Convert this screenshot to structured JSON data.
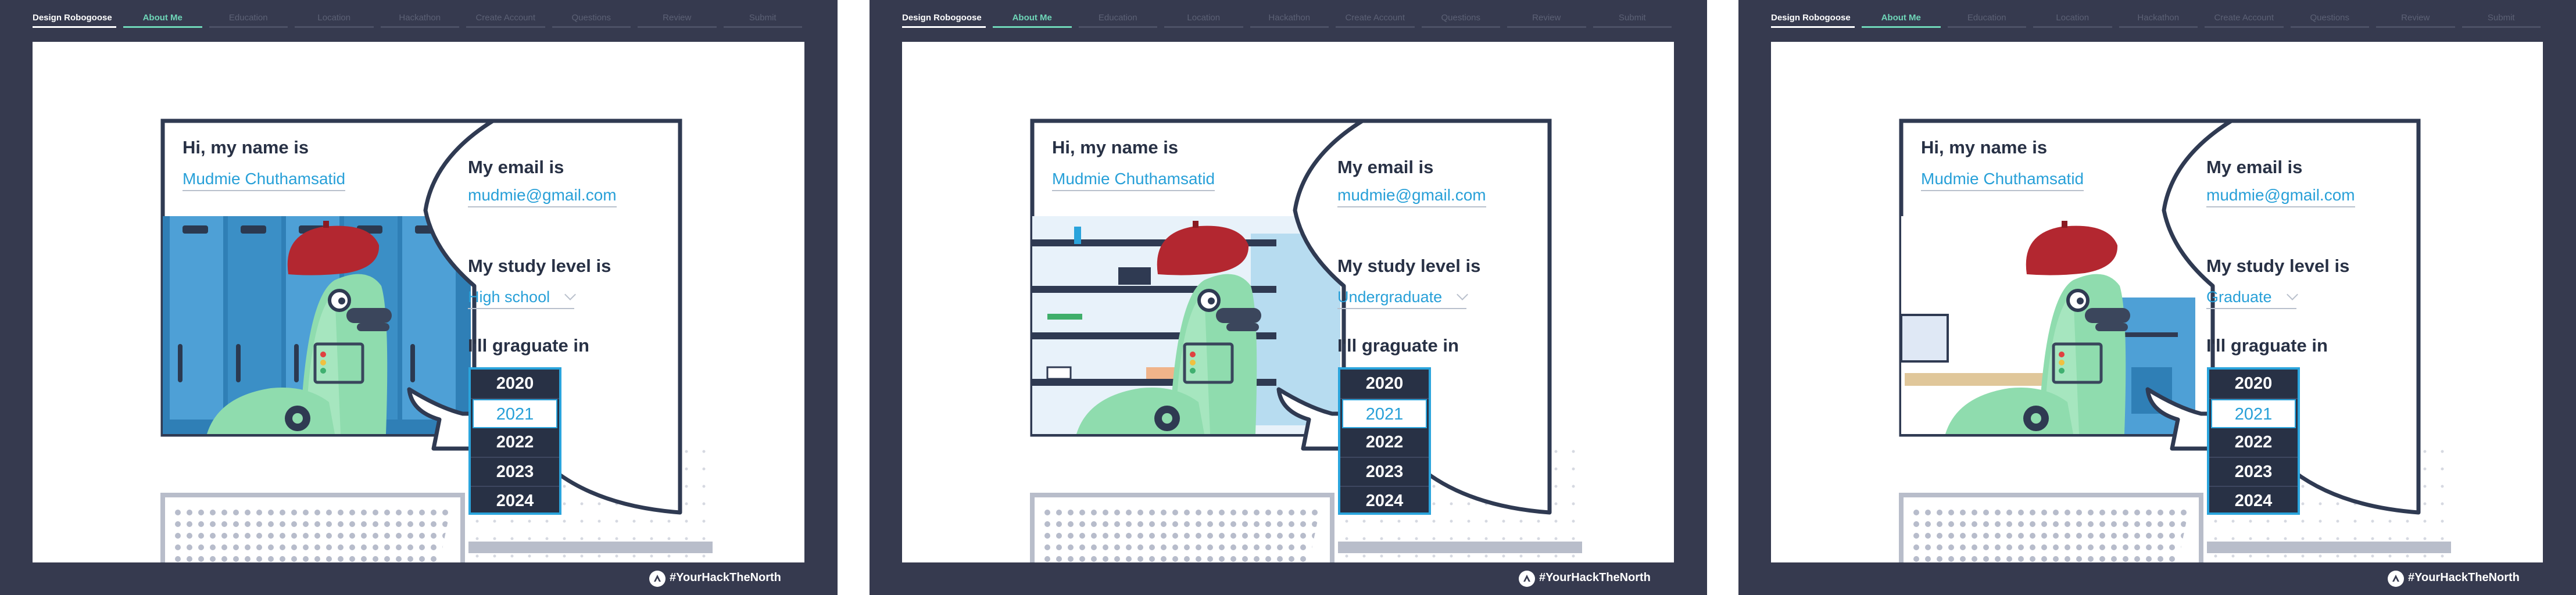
{
  "nav": {
    "brand": "Design Robogoose",
    "tabs": [
      "About Me",
      "Education",
      "Location",
      "Hackathon",
      "Create Account",
      "Questions",
      "Review",
      "Submit"
    ]
  },
  "form": {
    "name_label": "Hi, my name is",
    "email_label": "My email is",
    "study_label": "My study level is",
    "grad_label": "I'll graguate in",
    "grad_options": [
      "2020",
      "2021",
      "2022",
      "2023",
      "2024"
    ],
    "selected_year": "2021"
  },
  "screens": [
    {
      "name": "Mudmie Chuthamsatid",
      "email": "mudmie@gmail.com",
      "study_level": "High school",
      "scene": "lockers"
    },
    {
      "name": "Mudmie Chuthamsatid",
      "email": "mudmie@gmail.com",
      "study_level": "Undergraduate",
      "scene": "dorm-shelves"
    },
    {
      "name": "Mudmie Chuthamsatid",
      "email": "mudmie@gmail.com",
      "study_level": "Graduate",
      "scene": "office-desk"
    }
  ],
  "footer": {
    "hashtag": "#YourHackTheNorth"
  },
  "colors": {
    "frame": "#363a4f",
    "accent": "#6fd6b8",
    "link": "#28a0d8",
    "ink": "#283145"
  }
}
